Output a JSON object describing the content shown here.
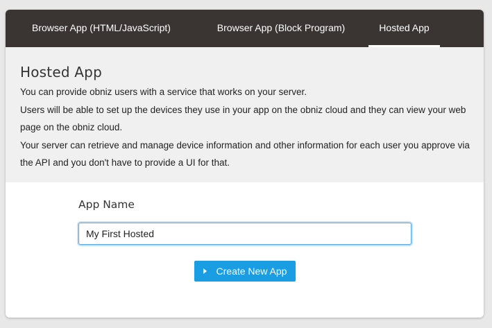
{
  "tabs": [
    {
      "label": "Browser App (HTML/JavaScript)",
      "active": false
    },
    {
      "label": "Browser App (Block Program)",
      "active": false
    },
    {
      "label": "Hosted App",
      "active": true
    }
  ],
  "info": {
    "title": "Hosted App",
    "paragraphs": [
      "You can provide obniz users with a service that works on your server.",
      "Users will be able to set up the devices they use in your app on the obniz cloud and they can view your web page on the obniz cloud.",
      "Your server can retrieve and manage device information and other information for each user you approve via the API and you don't have to provide a UI for that."
    ]
  },
  "form": {
    "label": "App Name",
    "input_value": "My First Hosted ",
    "button_label": "Create New App",
    "button_icon": "caret-right-icon"
  },
  "colors": {
    "tabbar": "#3a3533",
    "info_bg": "#f0f0f0",
    "button": "#1a9de3",
    "input_focus": "#5aa3e6"
  }
}
